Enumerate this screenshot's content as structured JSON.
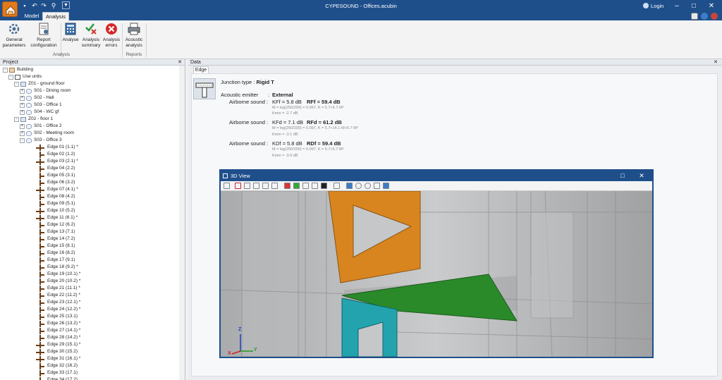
{
  "window": {
    "title": "CYPESOUND - Offices.acubin",
    "login_label": "Login"
  },
  "ribbon_tabs": [
    {
      "label": "Model"
    },
    {
      "label": "Analysis"
    }
  ],
  "ribbon": {
    "buttons": [
      {
        "label": "General parameters",
        "icon": "gear-icon"
      },
      {
        "label": "Report configuration",
        "icon": "report-config-icon"
      },
      {
        "label": "Analyse",
        "icon": "calculator-icon"
      },
      {
        "label": "Analysis summary",
        "icon": "check-x-icon"
      },
      {
        "label": "Analysis errors",
        "icon": "error-icon"
      },
      {
        "label": "Acoustic analysis",
        "icon": "printer-icon"
      }
    ],
    "groups": [
      {
        "label": "Analysis"
      },
      {
        "label": "Reports"
      }
    ]
  },
  "project_panel": {
    "title": "Project",
    "tree": [
      {
        "label": "Building",
        "level": 0,
        "icon": "building-icon",
        "expand": "-"
      },
      {
        "label": "Use units",
        "level": 1,
        "icon": "house-icon",
        "expand": "-"
      },
      {
        "label": "Z01 - ground floor",
        "level": 2,
        "icon": "zone-icon",
        "expand": "-"
      },
      {
        "label": "S01 - Dining room",
        "level": 3,
        "icon": "space-icon",
        "expand": "+"
      },
      {
        "label": "S02 - Hall",
        "level": 3,
        "icon": "space-icon",
        "expand": "+"
      },
      {
        "label": "S03 - Office 1",
        "level": 3,
        "icon": "space-icon",
        "expand": "+"
      },
      {
        "label": "S04 - WC gf",
        "level": 3,
        "icon": "space-icon",
        "expand": "+"
      },
      {
        "label": "Z02 - floor 1",
        "level": 2,
        "icon": "zone-icon",
        "expand": "-"
      },
      {
        "label": "S01 - Office 2",
        "level": 3,
        "icon": "space-icon",
        "expand": "+"
      },
      {
        "label": "S02 - Meeting room",
        "level": 3,
        "icon": "space-icon",
        "expand": "+"
      },
      {
        "label": "S03 - Office 3",
        "level": 3,
        "icon": "space-icon",
        "expand": "-"
      },
      {
        "label": "Edge 01  (1.1) *",
        "level": 4,
        "icon": "edge-icon",
        "shape": "T"
      },
      {
        "label": "Edge 02  (1.2)",
        "level": 4,
        "icon": "edge-icon",
        "shape": "L"
      },
      {
        "label": "Edge 03  (2.1) *",
        "level": 4,
        "icon": "edge-icon",
        "shape": "T"
      },
      {
        "label": "Edge 04  (2.2)",
        "level": 4,
        "icon": "edge-icon",
        "shape": "L"
      },
      {
        "label": "Edge 05  (3.1)",
        "level": 4,
        "icon": "edge-icon",
        "shape": "L"
      },
      {
        "label": "Edge 06  (3.2)",
        "level": 4,
        "icon": "edge-icon",
        "shape": "L"
      },
      {
        "label": "Edge 07  (4.1) *",
        "level": 4,
        "icon": "edge-icon",
        "shape": "T"
      },
      {
        "label": "Edge 08  (4.2)",
        "level": 4,
        "icon": "edge-icon",
        "shape": "L"
      },
      {
        "label": "Edge 09  (5.1)",
        "level": 4,
        "icon": "edge-icon",
        "shape": "L"
      },
      {
        "label": "Edge 10  (5.2)",
        "level": 4,
        "icon": "edge-icon",
        "shape": "T"
      },
      {
        "label": "Edge 11  (6.1) *",
        "level": 4,
        "icon": "edge-icon",
        "shape": "T"
      },
      {
        "label": "Edge 12  (6.2)",
        "level": 4,
        "icon": "edge-icon",
        "shape": "L"
      },
      {
        "label": "Edge 13  (7.1)",
        "level": 4,
        "icon": "edge-icon",
        "shape": "L"
      },
      {
        "label": "Edge 14  (7.2)",
        "level": 4,
        "icon": "edge-icon",
        "shape": "L"
      },
      {
        "label": "Edge 15  (8.1)",
        "level": 4,
        "icon": "edge-icon",
        "shape": "L"
      },
      {
        "label": "Edge 16  (8.2)",
        "level": 4,
        "icon": "edge-icon",
        "shape": "L"
      },
      {
        "label": "Edge 17  (9.1)",
        "level": 4,
        "icon": "edge-icon",
        "shape": "L"
      },
      {
        "label": "Edge 18  (9.2) *",
        "level": 4,
        "icon": "edge-icon",
        "shape": "L"
      },
      {
        "label": "Edge 19  (10.1) *",
        "level": 4,
        "icon": "edge-icon",
        "shape": "L"
      },
      {
        "label": "Edge 20  (10.2) *",
        "level": 4,
        "icon": "edge-icon",
        "shape": "L"
      },
      {
        "label": "Edge 21  (11.1) *",
        "level": 4,
        "icon": "edge-icon",
        "shape": "L"
      },
      {
        "label": "Edge 22  (11.2) *",
        "level": 4,
        "icon": "edge-icon",
        "shape": "L"
      },
      {
        "label": "Edge 23  (12.1) *",
        "level": 4,
        "icon": "edge-icon",
        "shape": "L"
      },
      {
        "label": "Edge 24  (12.2) *",
        "level": 4,
        "icon": "edge-icon",
        "shape": "L"
      },
      {
        "label": "Edge 25  (13.1)",
        "level": 4,
        "icon": "edge-icon",
        "shape": "L"
      },
      {
        "label": "Edge 26  (13.2) *",
        "level": 4,
        "icon": "edge-icon",
        "shape": "L"
      },
      {
        "label": "Edge 27  (14.1) *",
        "level": 4,
        "icon": "edge-icon",
        "shape": "L"
      },
      {
        "label": "Edge 28  (14.2) *",
        "level": 4,
        "icon": "edge-icon",
        "shape": "L"
      },
      {
        "label": "Edge 29  (15.1) *",
        "level": 4,
        "icon": "edge-icon",
        "shape": "T"
      },
      {
        "label": "Edge 30  (15.2)",
        "level": 4,
        "icon": "edge-icon",
        "shape": "T"
      },
      {
        "label": "Edge 31  (16.1) *",
        "level": 4,
        "icon": "edge-icon",
        "shape": "T"
      },
      {
        "label": "Edge 32  (16.2)",
        "level": 4,
        "icon": "edge-icon",
        "shape": "L"
      },
      {
        "label": "Edge 33  (17.1)",
        "level": 4,
        "icon": "edge-icon",
        "shape": "L"
      },
      {
        "label": "Edge 34  (17.2)",
        "level": 4,
        "icon": "edge-icon",
        "shape": "L"
      }
    ]
  },
  "data_panel": {
    "title": "Data",
    "tab": "Edge",
    "junction_label": "Junction type :",
    "junction_value": "Rigid T",
    "emitter_label": "Acoustic emitter",
    "emitter_sep": ":",
    "emitter_value": "External",
    "rows": [
      {
        "label": "Airborne sound :",
        "k": "KFf = 5.8 dB",
        "r": "RFf = 59.4 dB",
        "formula": "M = log(250/200) = 0.097, K = 5.7+5.7·M²",
        "kmin": "Kmin = -2.7 dB"
      },
      {
        "label": "Airborne sound :",
        "k": "KFd = 7.1 dB",
        "r": "RFd = 61.2 dB",
        "formula": "M = log(250/200) = 0.097, K = 5.7+14.1·M+5.7·M²",
        "kmin": "Kmin = -3.1 dB"
      },
      {
        "label": "Airborne sound :",
        "k": "KDf = 5.8 dB",
        "r": "RDf = 59.4 dB",
        "formula": "M = log(250/200) = 0.097, K = 5.7+5.7·M²",
        "kmin": "Kmin = -3.6 dB"
      }
    ]
  },
  "view3d": {
    "title": "3D View",
    "axis_labels": {
      "z": "Z",
      "x": "X",
      "y": "Y"
    },
    "colors": {
      "orange": "#d9851f",
      "green": "#2a8a2a",
      "cyan": "#23a3ad",
      "titlebar": "#1f4f8b"
    }
  }
}
